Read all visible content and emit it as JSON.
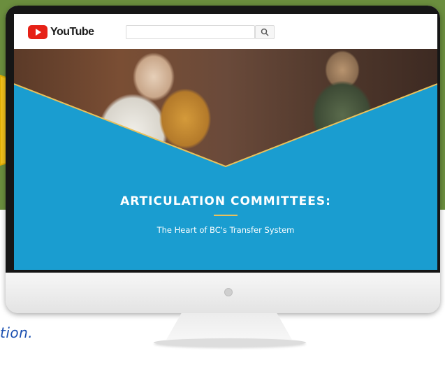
{
  "youtube": {
    "logo_text": "YouTube",
    "search_placeholder": "",
    "search_icon": "search-icon"
  },
  "video": {
    "title": "ARTICULATION COMMITTEES:",
    "subtitle": "The Heart of BC's Transfer System"
  },
  "caption": {
    "text": "tion."
  },
  "colors": {
    "backdrop_green": "#6b8e3e",
    "arrow_yellow": "#f2c21b",
    "screen_blue": "#1a9dd0",
    "accent_gold": "#e9c15c",
    "youtube_red": "#e62117",
    "caption_blue": "#1a4fb0"
  }
}
